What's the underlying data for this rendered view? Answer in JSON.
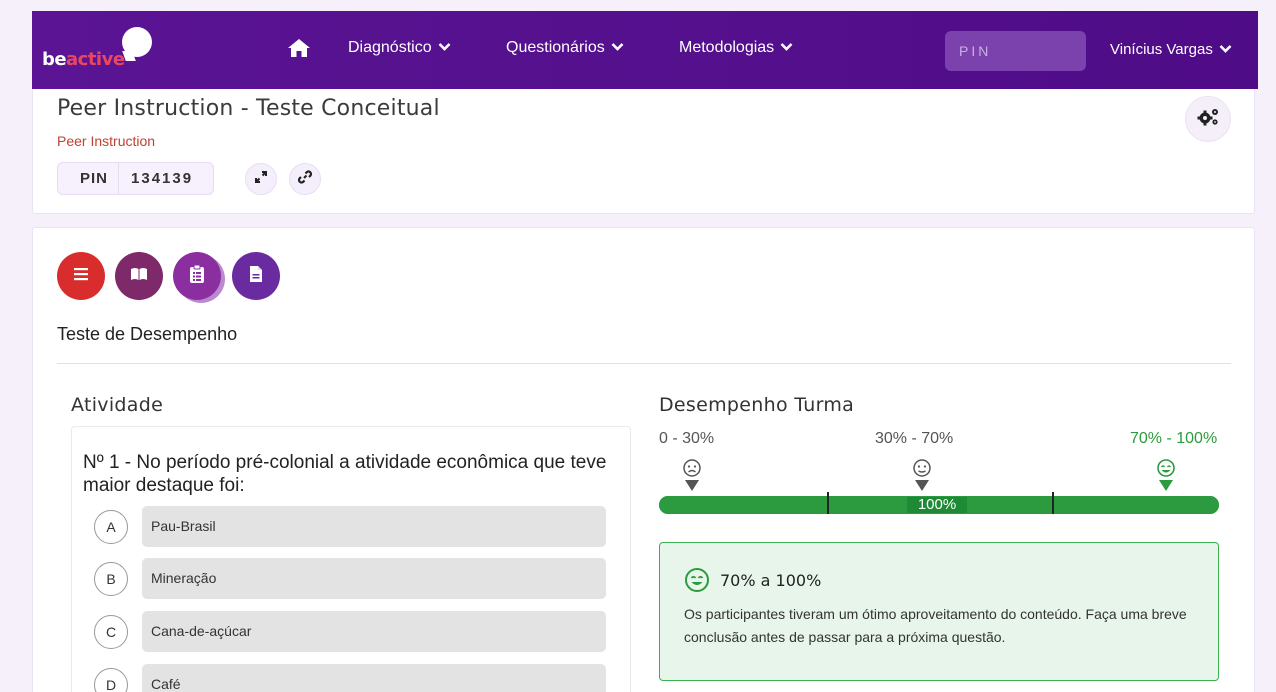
{
  "brand": {
    "part1": "be",
    "part2": "active"
  },
  "nav": {
    "items": [
      {
        "label": "Diagnóstico"
      },
      {
        "label": "Questionários"
      },
      {
        "label": "Metodologias"
      }
    ],
    "pin_placeholder": "PIN",
    "user": "Vinícius Vargas"
  },
  "header": {
    "title": "Peer Instruction - Teste Conceitual",
    "method": "Peer Instruction",
    "pin_label": "PIN",
    "pin_value": "134139"
  },
  "main": {
    "section_title": "Teste de Desempenho",
    "activity_title": "Atividade",
    "question": "Nº 1 - No período pré-colonial a atividade econômica que teve maior destaque foi:",
    "options": [
      {
        "letter": "A",
        "text": "Pau-Brasil"
      },
      {
        "letter": "B",
        "text": "Mineração"
      },
      {
        "letter": "C",
        "text": "Cana-de-açúcar"
      },
      {
        "letter": "D",
        "text": "Café"
      }
    ],
    "performance_title": "Desempenho Turma",
    "ranges": [
      "0 - 30%",
      "30% - 70%",
      "70% - 100%"
    ],
    "progress_label": "100%",
    "progress_fraction": 1.0,
    "feedback": {
      "title": "70% a 100%",
      "text": "Os participantes tiveram um ótimo aproveitamento do conteúdo. Faça uma breve conclusão antes de passar para a próxima questão."
    }
  },
  "colors": {
    "nav_bg": "#5a1494",
    "red_button": "#d92c2c",
    "purple_button": "#7e2a82",
    "violet_button": "#6a2aa0",
    "bar_green": "#2c9a3e",
    "range_active": "#2c9a3e"
  },
  "icons": [
    "home-icon",
    "chevron-down-icon",
    "expand-icon",
    "link-icon",
    "gears-icon",
    "list-icon",
    "book-icon",
    "clipboard-icon",
    "document-icon",
    "sad-face-icon",
    "neutral-face-icon",
    "happy-face-icon",
    "marker-icon"
  ]
}
